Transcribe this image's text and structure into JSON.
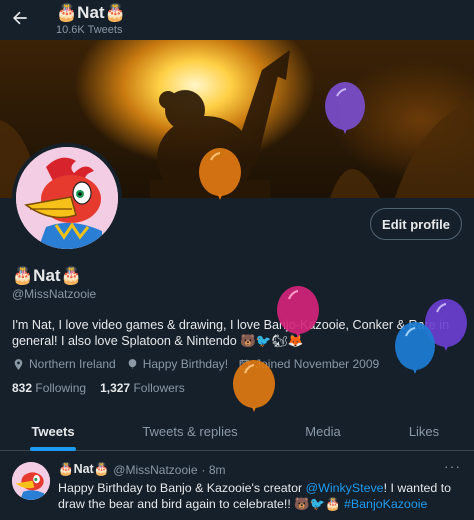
{
  "header": {
    "display_name": "🎂Nat🎂",
    "tweet_count": "10.6K Tweets"
  },
  "profile": {
    "edit_label": "Edit profile",
    "display_name": "🎂Nat🎂",
    "handle": "@MissNatzooie",
    "bio": "I'm Nat, I love video games & drawing, I love Banjo-Kazooie, Conker & Rare in general! I also love Splatoon & Nintendo 🐻🐦🐿🦊",
    "location": "Northern Ireland",
    "birthday": "Happy Birthday!",
    "joined": "Joined November 2009",
    "following_count": "832",
    "following_label": "Following",
    "followers_count": "1,327",
    "followers_label": "Followers"
  },
  "tabs": [
    {
      "label": "Tweets",
      "active": true
    },
    {
      "label": "Tweets & replies",
      "active": false
    },
    {
      "label": "Media",
      "active": false
    },
    {
      "label": "Likes",
      "active": false
    }
  ],
  "tweet": {
    "name": "🎂Nat🎂",
    "handle": "@MissNatzooie",
    "time": "· 8m",
    "more": "···",
    "text_before": "Happy Birthday to Banjo & Kazooie's creator ",
    "mention": "@WinkySteve",
    "text_middle": "! I wanted to draw the bear and bird again to celebrate!! 🐻🐦🎂 ",
    "hashtag": "#BanjoKazooie"
  },
  "colors": {
    "background": "#15202b",
    "accent": "#1d9bf0",
    "muted": "#8b98a5",
    "balloon_purple": "#7b4fd1",
    "balloon_orange": "#e07a12",
    "balloon_pink": "#d4247a",
    "balloon_blue": "#1d7dd4"
  },
  "icons": [
    "back-arrow-icon",
    "location-icon",
    "balloon-icon",
    "calendar-icon",
    "more-icon"
  ]
}
